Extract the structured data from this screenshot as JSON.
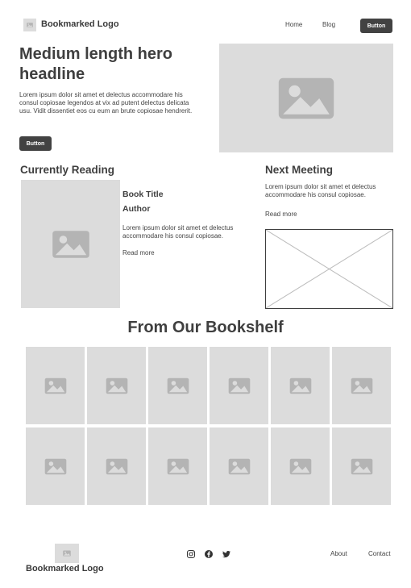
{
  "header": {
    "logo_text": "Bookmarked Logo",
    "nav": [
      "Home",
      "Blog"
    ],
    "button_label": "Button"
  },
  "hero": {
    "headline": "Medium length hero headline",
    "body": "Lorem ipsum dolor sit amet et delectus accommodare his consul copiosae legendos at vix ad putent delectus delicata usu. Vidit dissentiet eos cu eum an brute copiosae hendrerit.",
    "button_label": "Button"
  },
  "currently_reading": {
    "heading": "Currently Reading",
    "book_title": "Book Title",
    "author": "Author",
    "description": "Lorem ipsum dolor sit amet et delectus accommodare his consul copiosae.",
    "read_more": "Read more"
  },
  "next_meeting": {
    "heading": "Next Meeting",
    "description": "Lorem ipsum dolor sit amet et delectus accommodare his consul copiosae.",
    "read_more": "Read more"
  },
  "bookshelf": {
    "heading": "From Our Bookshelf",
    "item_count": 12
  },
  "footer": {
    "logo_text": "Bookmarked Logo",
    "social_icons": [
      "instagram-icon",
      "facebook-icon",
      "twitter-icon"
    ],
    "links": [
      "About",
      "Contact"
    ]
  },
  "colors": {
    "placeholder": "#dcdcdc",
    "placeholder_icon": "#b4b4b4",
    "button": "#424242",
    "text": "#3f3f3f"
  }
}
